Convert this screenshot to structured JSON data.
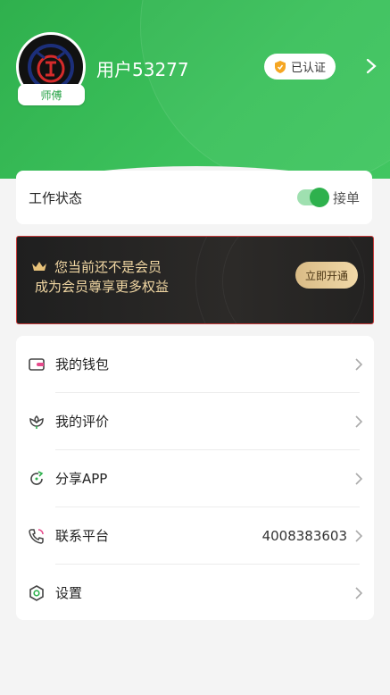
{
  "profile": {
    "username": "用户53277",
    "role_badge": "师傅",
    "verified_label": "已认证"
  },
  "work_status": {
    "label": "工作状态",
    "toggle_on": true,
    "toggle_label": "接单"
  },
  "vip_banner": {
    "line1": "您当前还不是会员",
    "line2": "成为会员尊享更多权益",
    "button": "立即开通"
  },
  "menu": [
    {
      "label": "我的钱包",
      "icon": "wallet-icon",
      "value": ""
    },
    {
      "label": "我的评价",
      "icon": "flower-icon",
      "value": ""
    },
    {
      "label": "分享APP",
      "icon": "share-icon",
      "value": ""
    },
    {
      "label": "联系平台",
      "icon": "phone-icon",
      "value": "4008383603"
    },
    {
      "label": "设置",
      "icon": "settings-icon",
      "value": ""
    }
  ],
  "colors": {
    "brand_green": "#2eb14d",
    "gold": "#f1d7a3"
  }
}
